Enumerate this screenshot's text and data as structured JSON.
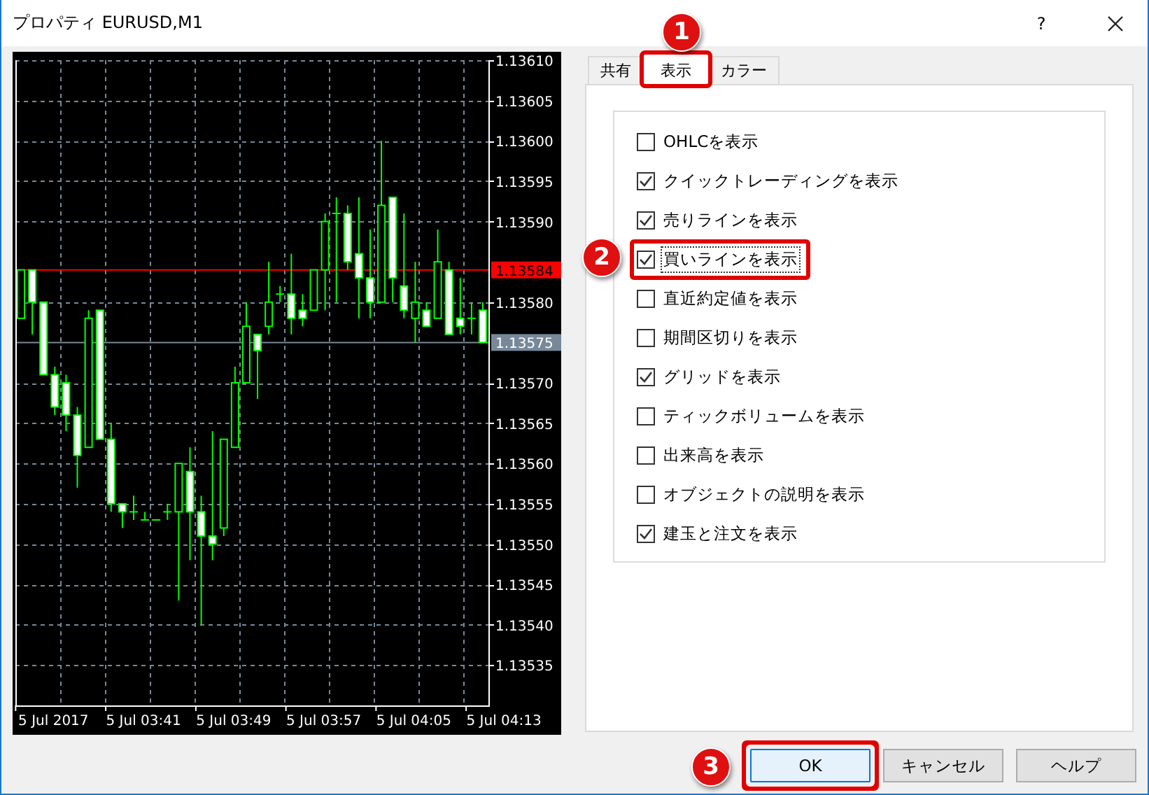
{
  "window": {
    "title": "プロパティ EURUSD,M1",
    "help": "?"
  },
  "chart": {
    "chart_data": {
      "type": "candlestick",
      "grid": true,
      "categories": [
        null,
        null,
        null,
        "5 Jul 2017",
        null,
        null,
        null,
        null,
        null,
        null,
        null,
        "5 Jul 03:41",
        null,
        null,
        null,
        null,
        null,
        null,
        null,
        "5 Jul 03:49",
        null,
        null,
        null,
        null,
        null,
        null,
        null,
        "5 Jul 03:57",
        null,
        null,
        null,
        null,
        null,
        null,
        null,
        "5 Jul 04:05",
        null,
        null,
        null,
        null,
        null,
        null,
        null,
        "5 Jul 04:13"
      ],
      "ref_lines": [
        {
          "axis": "y",
          "value": 1.13584,
          "color": "#ff0000",
          "label": "1.13584"
        },
        {
          "axis": "y",
          "value": 1.13575,
          "color": "#778899",
          "label": "1.13575"
        }
      ],
      "ohlc": [
        [
          1.13578,
          1.13584,
          1.13578,
          1.13584
        ],
        [
          1.13584,
          1.13584,
          1.13576,
          1.1358
        ],
        [
          1.1358,
          1.1358,
          1.13571,
          1.13571
        ],
        [
          1.13571,
          1.13572,
          1.13566,
          1.13567
        ],
        [
          1.1357,
          1.13571,
          1.13564,
          1.13566
        ],
        [
          1.13566,
          1.13567,
          1.13557,
          1.13561
        ],
        [
          1.13562,
          1.13579,
          1.13562,
          1.13578
        ],
        [
          1.13579,
          1.13579,
          1.13563,
          1.13563
        ],
        [
          1.13563,
          1.13565,
          1.13554,
          1.13555
        ],
        [
          1.13555,
          1.13555,
          1.13552,
          1.13554
        ],
        [
          1.13554,
          1.13556,
          1.13553,
          1.13554
        ],
        [
          1.13553,
          1.13554,
          1.13553,
          1.13553
        ],
        [
          1.13553,
          1.13553,
          1.13553,
          1.13553
        ],
        [
          1.13554,
          1.13555,
          1.13553,
          1.13554
        ],
        [
          1.13554,
          1.1356,
          1.13543,
          1.1356
        ],
        [
          1.13559,
          1.13562,
          1.13548,
          1.13554
        ],
        [
          1.13554,
          1.13556,
          1.1354,
          1.13551
        ],
        [
          1.13551,
          1.13564,
          1.13548,
          1.1355
        ],
        [
          1.13552,
          1.13563,
          1.13551,
          1.13563
        ],
        [
          1.13562,
          1.13572,
          1.13562,
          1.1357
        ],
        [
          1.1357,
          1.1358,
          1.1357,
          1.13577
        ],
        [
          1.13576,
          1.13576,
          1.13568,
          1.13574
        ],
        [
          1.13577,
          1.13585,
          1.13576,
          1.1358
        ],
        [
          1.13581,
          1.13582,
          1.1358,
          1.13581
        ],
        [
          1.13581,
          1.13586,
          1.13576,
          1.13578
        ],
        [
          1.13579,
          1.13581,
          1.13577,
          1.13578
        ],
        [
          1.13579,
          1.13584,
          1.13579,
          1.13584
        ],
        [
          1.13584,
          1.13591,
          1.13579,
          1.1359
        ],
        [
          1.13591,
          1.13593,
          1.1358,
          1.13591
        ],
        [
          1.13591,
          1.13592,
          1.13584,
          1.13585
        ],
        [
          1.13586,
          1.13593,
          1.13578,
          1.13583
        ],
        [
          1.13583,
          1.13589,
          1.13578,
          1.1358
        ],
        [
          1.1358,
          1.136,
          1.1358,
          1.13592
        ],
        [
          1.13593,
          1.13593,
          1.1358,
          1.13583
        ],
        [
          1.13582,
          1.13591,
          1.13578,
          1.13579
        ],
        [
          1.13578,
          1.13585,
          1.13575,
          1.1358
        ],
        [
          1.13579,
          1.1358,
          1.13577,
          1.13577
        ],
        [
          1.13578,
          1.13589,
          1.13578,
          1.13585
        ],
        [
          1.13584,
          1.13585,
          1.13576,
          1.13576
        ],
        [
          1.13578,
          1.13583,
          1.13576,
          1.13577
        ],
        [
          1.13578,
          1.1358,
          1.13576,
          1.13578
        ],
        [
          1.13579,
          1.1358,
          1.13575,
          1.13575
        ],
        null,
        null
      ],
      "ylim": [
        1.1353,
        1.1361
      ],
      "yticks": [
        {
          "value": 1.1361,
          "label": "1.13610"
        },
        {
          "value": 1.13605,
          "label": "1.13605"
        },
        {
          "value": 1.136,
          "label": "1.13600"
        },
        {
          "value": 1.13595,
          "label": "1.13595"
        },
        {
          "value": 1.1359,
          "label": "1.13590"
        },
        {
          "value": 1.1358,
          "label": "1.13580"
        },
        {
          "value": 1.1357,
          "label": "1.13570"
        },
        {
          "value": 1.13565,
          "label": "1.13565"
        },
        {
          "value": 1.1356,
          "label": "1.13560"
        },
        {
          "value": 1.13555,
          "label": "1.13555"
        },
        {
          "value": 1.1355,
          "label": "1.13550"
        },
        {
          "value": 1.13545,
          "label": "1.13545"
        },
        {
          "value": 1.1354,
          "label": "1.13540"
        },
        {
          "value": 1.13535,
          "label": "1.13535"
        }
      ]
    }
  },
  "tabs": [
    {
      "label": "共有",
      "selected": false,
      "highlighted": false
    },
    {
      "label": "表示",
      "selected": true,
      "highlighted": true,
      "marker": "1"
    },
    {
      "label": "カラー",
      "selected": false,
      "highlighted": false
    }
  ],
  "options": [
    {
      "label": "OHLCを表示",
      "checked": false,
      "focused": false,
      "highlighted": false
    },
    {
      "label": "クイックトレーディングを表示",
      "checked": true,
      "focused": false,
      "highlighted": false
    },
    {
      "label": "売りラインを表示",
      "checked": true,
      "focused": false,
      "highlighted": false
    },
    {
      "label": "買いラインを表示",
      "checked": true,
      "focused": true,
      "highlighted": true,
      "marker": "2"
    },
    {
      "label": "直近約定値を表示",
      "checked": false,
      "focused": false,
      "highlighted": false
    },
    {
      "label": "期間区切りを表示",
      "checked": false,
      "focused": false,
      "highlighted": false
    },
    {
      "label": "グリッドを表示",
      "checked": true,
      "focused": false,
      "highlighted": false
    },
    {
      "label": "ティックボリュームを表示",
      "checked": false,
      "focused": false,
      "highlighted": false
    },
    {
      "label": "出来高を表示",
      "checked": false,
      "focused": false,
      "highlighted": false
    },
    {
      "label": "オブジェクトの説明を表示",
      "checked": false,
      "focused": false,
      "highlighted": false
    },
    {
      "label": "建玉と注文を表示",
      "checked": true,
      "focused": false,
      "highlighted": false
    }
  ],
  "buttons": [
    {
      "label": "OK",
      "default": true,
      "highlighted": true,
      "marker": "3"
    },
    {
      "label": "キャンセル",
      "default": false,
      "highlighted": false
    },
    {
      "label": "ヘルプ",
      "default": false,
      "highlighted": false
    }
  ]
}
